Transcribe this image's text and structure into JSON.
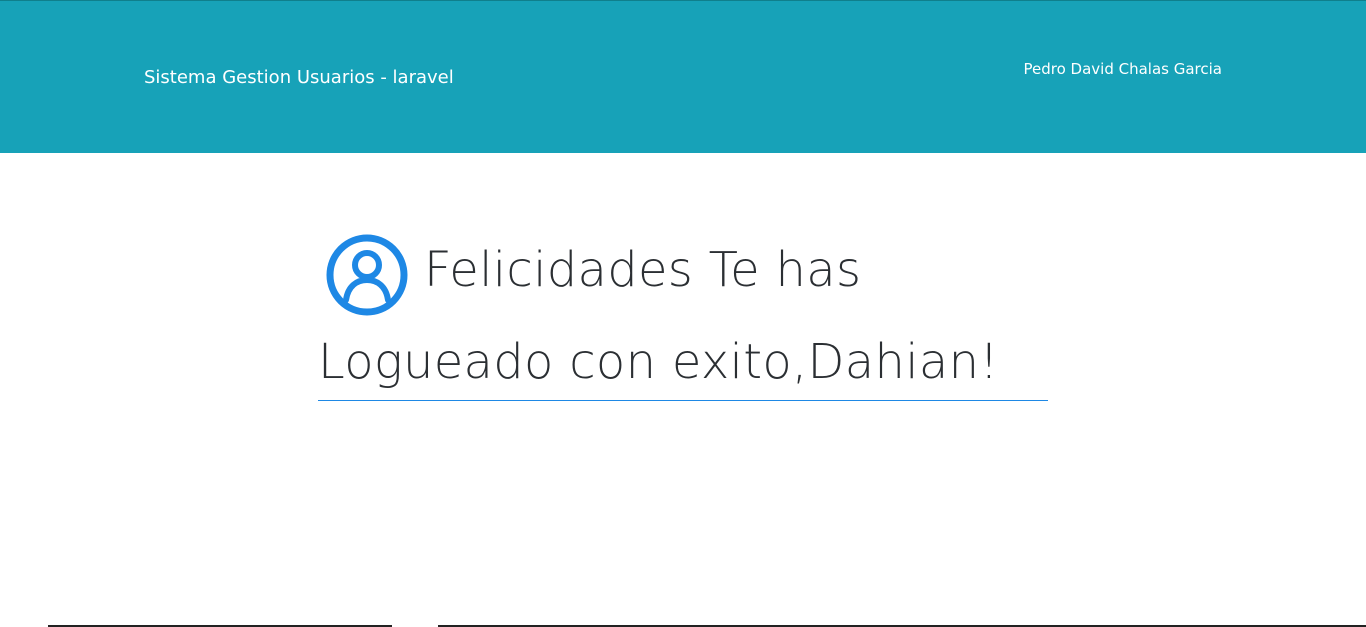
{
  "navbar": {
    "brand": "Sistema Gestion Usuarios - laravel",
    "user": "Pedro David Chalas Garcia",
    "bg_color": "#17a2b8"
  },
  "greeting": {
    "icon": "user-circle-icon",
    "icon_color": "#1e88e5",
    "line1": "Felicidades Te has",
    "line2": "Logueado con exito,Dahian!"
  }
}
